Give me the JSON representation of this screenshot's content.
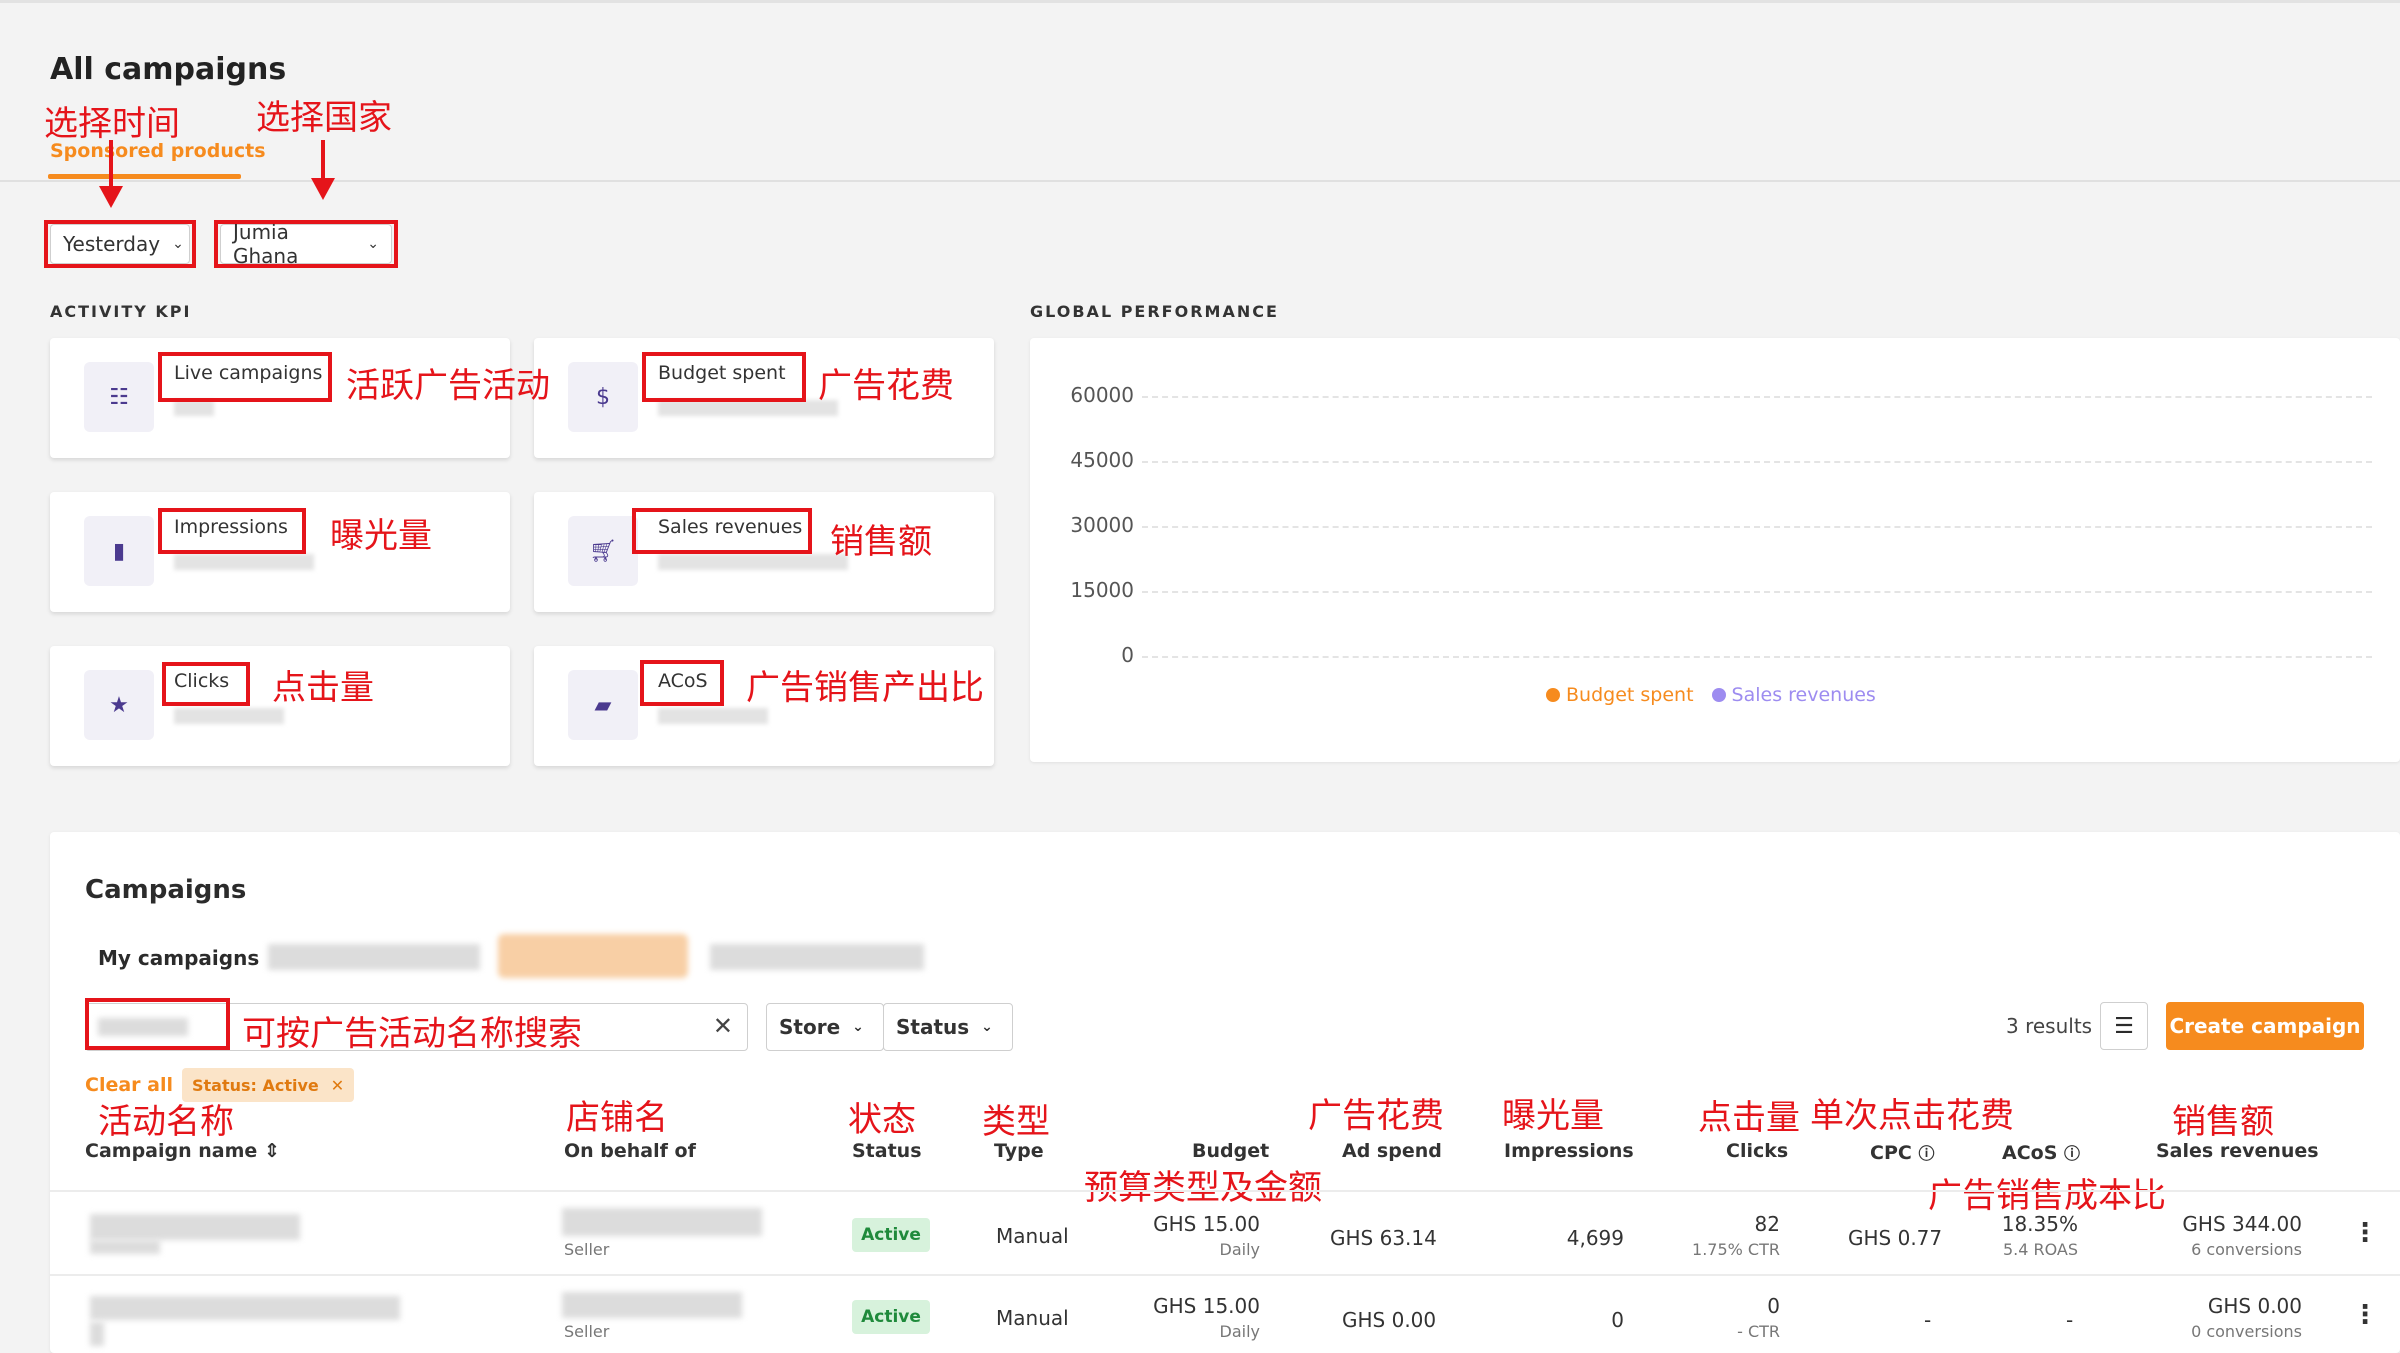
{
  "header": {
    "title": "All campaigns",
    "tab_label": "Sponsored products"
  },
  "filters": {
    "date": "Yesterday",
    "country": "Jumia Ghana"
  },
  "annotations": {
    "date": "选择时间",
    "country": "选择国家",
    "live_campaigns": "活跃广告活动",
    "budget_spent": "广告花费",
    "impressions": "曝光量",
    "sales_revenues": "销售额",
    "clicks": "点击量",
    "acos": "广告销售产出比",
    "search": "可按广告活动名称搜索",
    "col_campaign": "活动名称",
    "col_store": "店铺名",
    "col_status": "状态",
    "col_type": "类型",
    "col_adspend": "广告花费",
    "col_impressions": "曝光量",
    "col_clicks": "点击量",
    "col_cpc": "单次点击花费",
    "col_budget": "预算类型及金额",
    "col_sales": "销售额",
    "col_acos": "广告销售成本比"
  },
  "kpi": {
    "section_label": "ACTIVITY KPI",
    "cards": [
      {
        "label": "Live campaigns",
        "icon": "sliders-icon"
      },
      {
        "label": "Budget spent",
        "icon": "dollar-coin-icon"
      },
      {
        "label": "Impressions",
        "icon": "bar-chart-icon"
      },
      {
        "label": "Sales revenues",
        "icon": "cart-icon"
      },
      {
        "label": "Clicks",
        "icon": "star-icon"
      },
      {
        "label": "ACoS",
        "icon": "briefcase-icon"
      }
    ]
  },
  "global_performance": {
    "section_label": "GLOBAL PERFORMANCE",
    "y_ticks": [
      "60000",
      "45000",
      "30000",
      "15000",
      "0"
    ],
    "legend": [
      {
        "label": "Budget spent",
        "color": "#f68b1e"
      },
      {
        "label": "Sales revenues",
        "color": "#9d8cf0"
      }
    ]
  },
  "chart_data": {
    "type": "line",
    "series": [
      {
        "name": "Budget spent",
        "values": []
      },
      {
        "name": "Sales revenues",
        "values": []
      }
    ],
    "ylim": [
      0,
      60000
    ],
    "y_ticks": [
      0,
      15000,
      30000,
      45000,
      60000
    ],
    "grid": true,
    "legend": "bottom"
  },
  "campaigns": {
    "title": "Campaigns",
    "my_campaigns_label": "My campaigns",
    "store_filter": "Store",
    "status_filter": "Status",
    "results": "3 results",
    "create_button": "Create campaign",
    "clear_all": "Clear all",
    "active_chip": "Status: Active",
    "columns": {
      "campaign_name": "Campaign name",
      "on_behalf_of": "On behalf of",
      "status": "Status",
      "type": "Type",
      "budget": "Budget",
      "ad_spend": "Ad spend",
      "impressions": "Impressions",
      "clicks": "Clicks",
      "cpc": "CPC",
      "acos": "ACoS",
      "sales_revenues": "Sales revenues"
    },
    "rows": [
      {
        "seller": "Seller",
        "status": "Active",
        "type": "Manual",
        "budget": "GHS 15.00",
        "budget_type": "Daily",
        "ad_spend": "GHS 63.14",
        "impressions": "4,699",
        "clicks": "82",
        "ctr": "1.75% CTR",
        "cpc": "GHS 0.77",
        "acos": "18.35%",
        "roas": "5.4 ROAS",
        "sales": "GHS 344.00",
        "conversions": "6 conversions"
      },
      {
        "seller": "Seller",
        "status": "Active",
        "type": "Manual",
        "budget": "GHS 15.00",
        "budget_type": "Daily",
        "ad_spend": "GHS 0.00",
        "impressions": "0",
        "clicks": "0",
        "ctr": "- CTR",
        "cpc": "-",
        "acos": "-",
        "roas": "",
        "sales": "GHS 0.00",
        "conversions": "0 conversions"
      }
    ]
  }
}
